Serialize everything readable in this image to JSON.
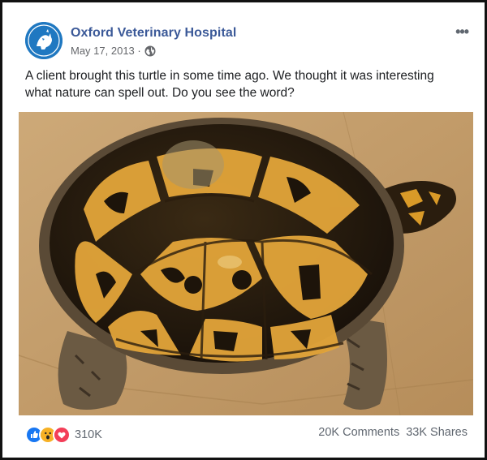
{
  "post": {
    "author": "Oxford Veterinary Hospital",
    "date": "May 17, 2013 · ",
    "more_label": "•••",
    "text": "A client brought this turtle in some time ago. We thought it was interesting what nature can spell out. Do you see the word?",
    "reactions": {
      "icons": [
        "like-icon",
        "wow-icon",
        "love-icon"
      ],
      "count": "310K"
    },
    "comments": "20K Comments",
    "shares": "33K Shares"
  },
  "colors": {
    "brand": "#3b5998",
    "meta": "#65676b",
    "like": "#1877f2",
    "love": "#f33e58",
    "wow": "#f7b125"
  },
  "photo": {
    "subject": "turtle-shell",
    "icon": "turtle-photo"
  }
}
